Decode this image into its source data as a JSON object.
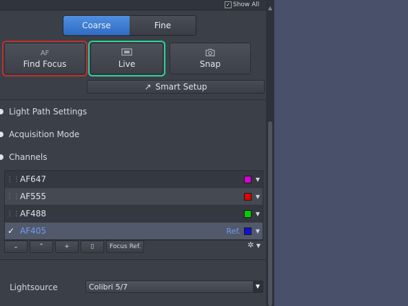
{
  "header": {
    "show_all_label": "Show All",
    "show_all_checked": true
  },
  "focus_mode": {
    "coarse_label": "Coarse",
    "fine_label": "Fine",
    "selected": "Coarse"
  },
  "actions": {
    "find_focus": {
      "icon_text": "AF",
      "label": "Find Focus"
    },
    "live": {
      "label": "Live"
    },
    "snap": {
      "label": "Snap"
    }
  },
  "smart_setup": {
    "label": "Smart Setup"
  },
  "sections": [
    {
      "label": "Light Path Settings"
    },
    {
      "label": "Acquisition Mode"
    },
    {
      "label": "Channels"
    }
  ],
  "channels": [
    {
      "name": "AF647",
      "color": "#d000d0",
      "selected": false,
      "ref": ""
    },
    {
      "name": "AF555",
      "color": "#e00000",
      "selected": false,
      "ref": ""
    },
    {
      "name": "AF488",
      "color": "#00d000",
      "selected": false,
      "ref": ""
    },
    {
      "name": "AF405",
      "color": "#1010d0",
      "selected": true,
      "ref": "Ref."
    }
  ],
  "channel_toolbar": {
    "focus_ref_label": "Focus Ref."
  },
  "lightsource": {
    "label": "Lightsource",
    "value": "Colibri 5/7"
  },
  "highlight_colors": {
    "red": "#c0322a",
    "green": "#2fd39a",
    "accent": "#3a7ad4"
  }
}
